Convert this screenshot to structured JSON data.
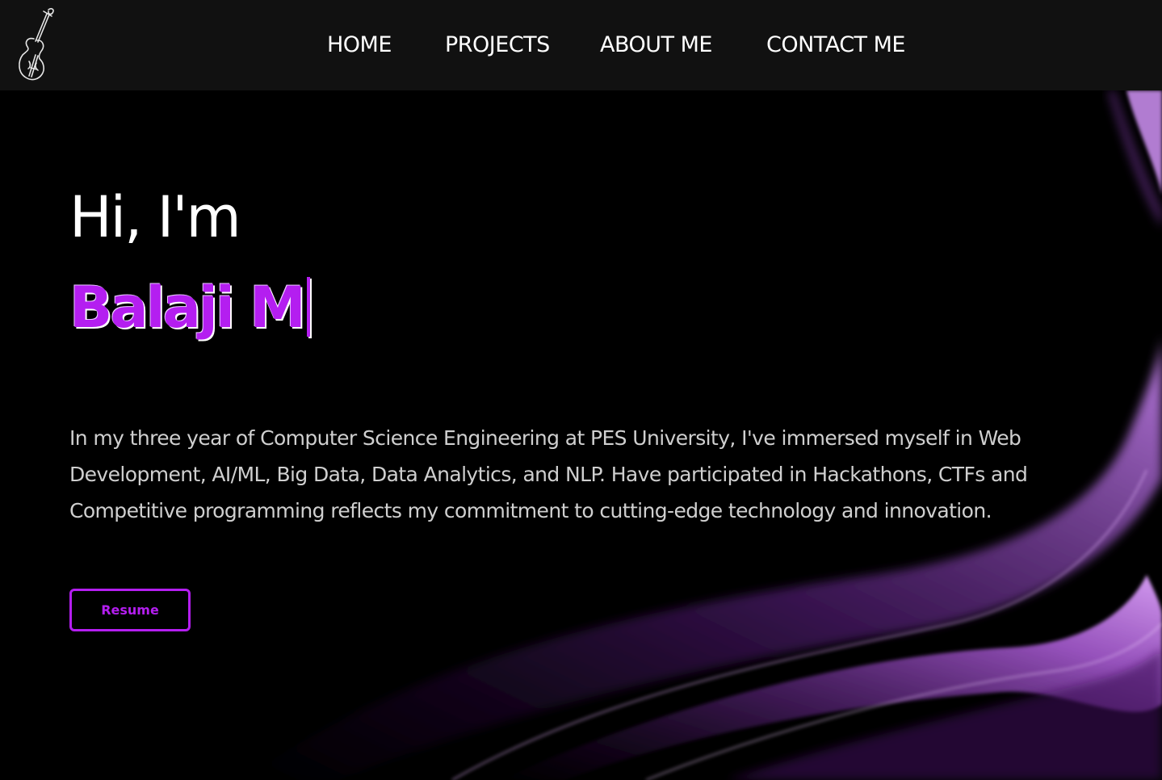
{
  "nav": {
    "logo_icon": "violin-icon",
    "links": [
      {
        "label": "HOME"
      },
      {
        "label": "PROJECTS"
      },
      {
        "label": "ABOUT ME"
      },
      {
        "label": "CONTACT ME"
      }
    ]
  },
  "hero": {
    "greeting": "Hi, I'm",
    "name": "Balaji M",
    "typing_cursor": "|",
    "bio": "In my three year of Computer Science Engineering at PES University, I've immersed myself in Web Development, AI/ML, Big Data, Data Analytics, and NLP. Have participated in Hackathons, CTFs and Competitive programming reflects my commitment to cutting-edge technology and innovation.",
    "resume_label": "Resume"
  },
  "colors": {
    "accent": "#b41ef0",
    "navbar_bg": "#111111",
    "page_bg": "#000000",
    "text": "#ffffff",
    "bio_text": "#cfcfcf"
  }
}
